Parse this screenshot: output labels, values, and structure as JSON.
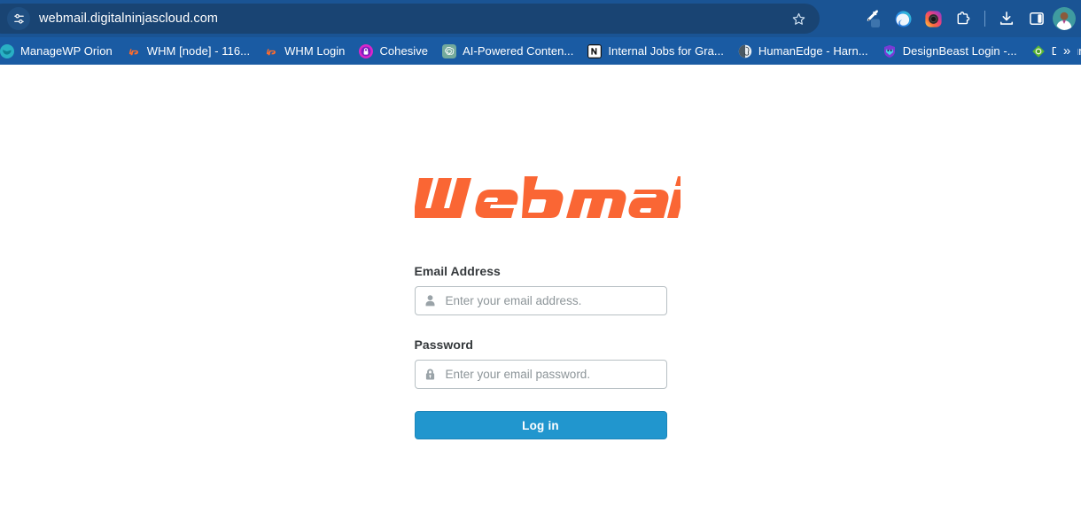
{
  "browser": {
    "omnibox": {
      "url": "webmail.digitalninjascloud.com",
      "site_info_icon": "tune-sliders-icon",
      "bookmark_star_icon": "star-outline-icon"
    },
    "toolbar_actions": [
      {
        "name": "eyedropper-extension-icon",
        "label": "Eyedropper"
      },
      {
        "name": "edge-wave-extension-icon",
        "label": "Wave"
      },
      {
        "name": "camera-ring-extension-icon",
        "label": "Camera"
      },
      {
        "name": "extensions-puzzle-icon",
        "label": "Extensions"
      },
      {
        "name": "downloads-icon",
        "label": "Downloads"
      },
      {
        "name": "side-panel-icon",
        "label": "Side panel"
      },
      {
        "name": "profile-avatar",
        "label": "Profile"
      }
    ],
    "bookmarks": [
      {
        "label": "ManageWP Orion",
        "icon": "managewp-icon"
      },
      {
        "label": "WHM [node] - 116...",
        "icon": "cpanel-icon"
      },
      {
        "label": "WHM Login",
        "icon": "cpanel-icon"
      },
      {
        "label": "Cohesive",
        "icon": "cohesive-icon"
      },
      {
        "label": "AI-Powered Conten...",
        "icon": "openai-icon"
      },
      {
        "label": "Internal Jobs for Gra...",
        "icon": "notion-icon"
      },
      {
        "label": "HumanEdge - Harn...",
        "icon": "humanedge-icon"
      },
      {
        "label": "DesignBeast Login -...",
        "icon": "designbeast-icon"
      },
      {
        "label": "Documents",
        "icon": "documents-icon"
      }
    ],
    "bookmarks_overflow_label": "»"
  },
  "login": {
    "logo_text": "Webmail",
    "email": {
      "label": "Email Address",
      "placeholder": "Enter your email address.",
      "value": "",
      "icon": "user-icon"
    },
    "password": {
      "label": "Password",
      "placeholder": "Enter your email password.",
      "value": "",
      "icon": "lock-icon"
    },
    "submit_label": "Log in"
  },
  "colors": {
    "brand_orange": "#fa6634",
    "button_blue": "#2196ce",
    "chrome_blue": "#1a5494",
    "bookmarks_blue": "#1a5ba3"
  }
}
